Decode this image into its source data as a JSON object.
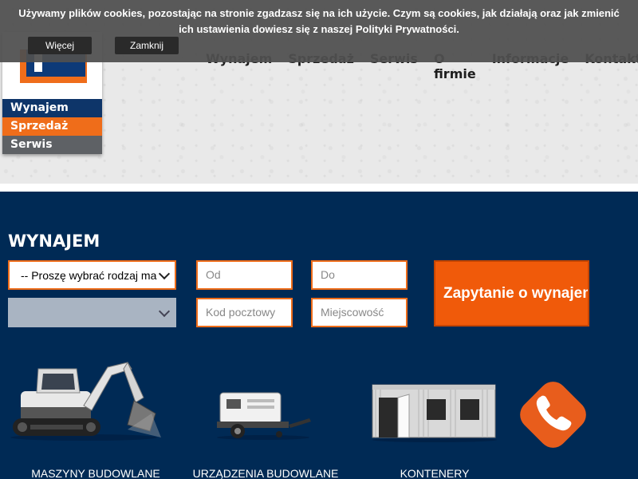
{
  "cookie": {
    "message": "Używamy plików cookies, pozostając na stronie zgadzasz się na ich użycie. Czym są cookies, jak działają oraz jak zmienić ich ustawienia dowiesz się z naszej Polityki Prywatności.",
    "more_label": "Więcej",
    "close_label": "Zamknij"
  },
  "logo": {
    "bands": [
      "Wynajem",
      "Sprzedaż",
      "Serwis"
    ]
  },
  "topnav": [
    "Wynajem",
    "Sprzedaż",
    "Serwis",
    "O firmie",
    "Informacje",
    "Kontakt"
  ],
  "rental": {
    "title": "WYNAJEM",
    "type_select_value": "-- Proszę wybrać rodzaj maszyny --",
    "subtype_select_value": "",
    "from_placeholder": "Od",
    "to_placeholder": "Do",
    "postcode_placeholder": "Kod pocztowy",
    "city_placeholder": "Miejscowość",
    "submit_label": "Zapytanie o wynajem"
  },
  "categories": [
    "MASZYNY BUDOWLANE",
    "URZĄDZENIA BUDOWLANE",
    "KONTENERY"
  ],
  "colors": {
    "navy": "#002a55",
    "orange": "#ef6d1a",
    "submit_orange": "#f05a0a",
    "cookie_bg": "#505050"
  },
  "icons": {
    "phone": "phone-icon"
  }
}
